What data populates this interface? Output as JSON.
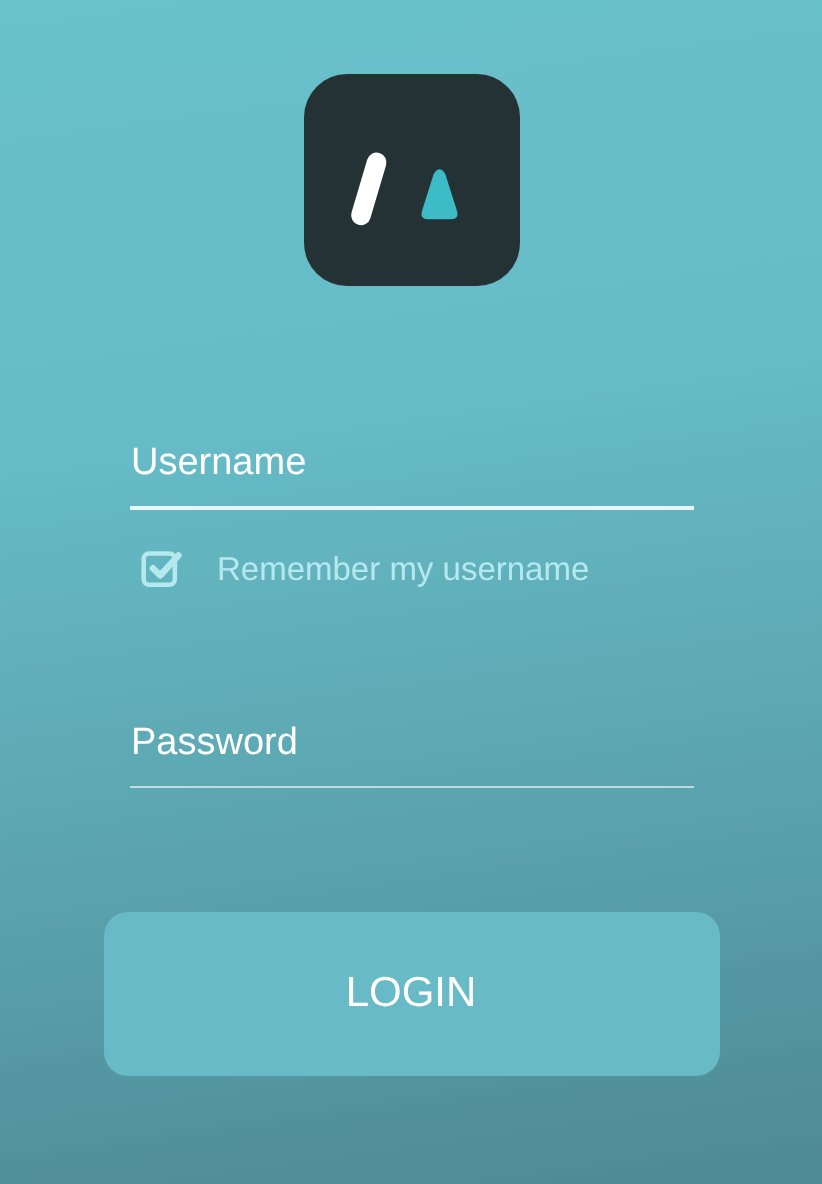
{
  "username": {
    "placeholder": "Username"
  },
  "remember": {
    "label": "Remember my username",
    "checked": true
  },
  "password": {
    "placeholder": "Password"
  },
  "login_button": {
    "label": "LOGIN"
  }
}
